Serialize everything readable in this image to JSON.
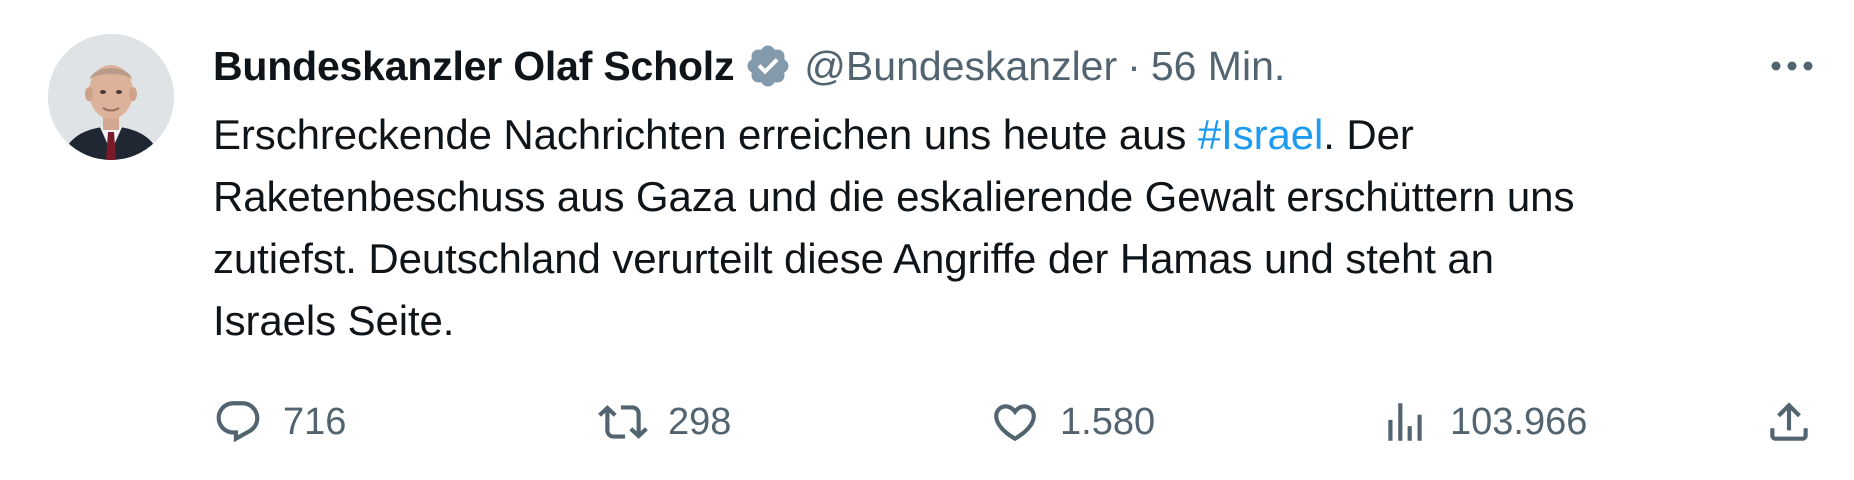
{
  "tweet": {
    "author": {
      "display_name": "Bundeskanzler Olaf Scholz",
      "handle": "@Bundeskanzler",
      "verified_icon": "verified-badge-icon"
    },
    "separator": "·",
    "timestamp": "56 Min.",
    "more_icon": "more-horizontal-icon",
    "text": {
      "line1_before": "Erschreckende Nachrichten erreichen uns heute aus ",
      "hashtag": "#Israel",
      "line1_after": ". Der",
      "line2": "Raketenbeschuss aus Gaza und die eskalierende Gewalt erschüttern uns",
      "line3": "zutiefst. Deutschland verurteilt diese Angriffe der Hamas und steht an",
      "line4": "Israels Seite."
    },
    "actions": {
      "replies": {
        "icon": "reply-icon",
        "count": "716"
      },
      "retweets": {
        "icon": "retweet-icon",
        "count": "298"
      },
      "likes": {
        "icon": "heart-icon",
        "count": "1.580"
      },
      "views": {
        "icon": "views-chart-icon",
        "count": "103.966"
      },
      "share": {
        "icon": "share-icon"
      }
    }
  },
  "colors": {
    "text_primary": "#0f1419",
    "text_secondary": "#536471",
    "link": "#1d9bf0",
    "verified_badge": "#829aab"
  }
}
